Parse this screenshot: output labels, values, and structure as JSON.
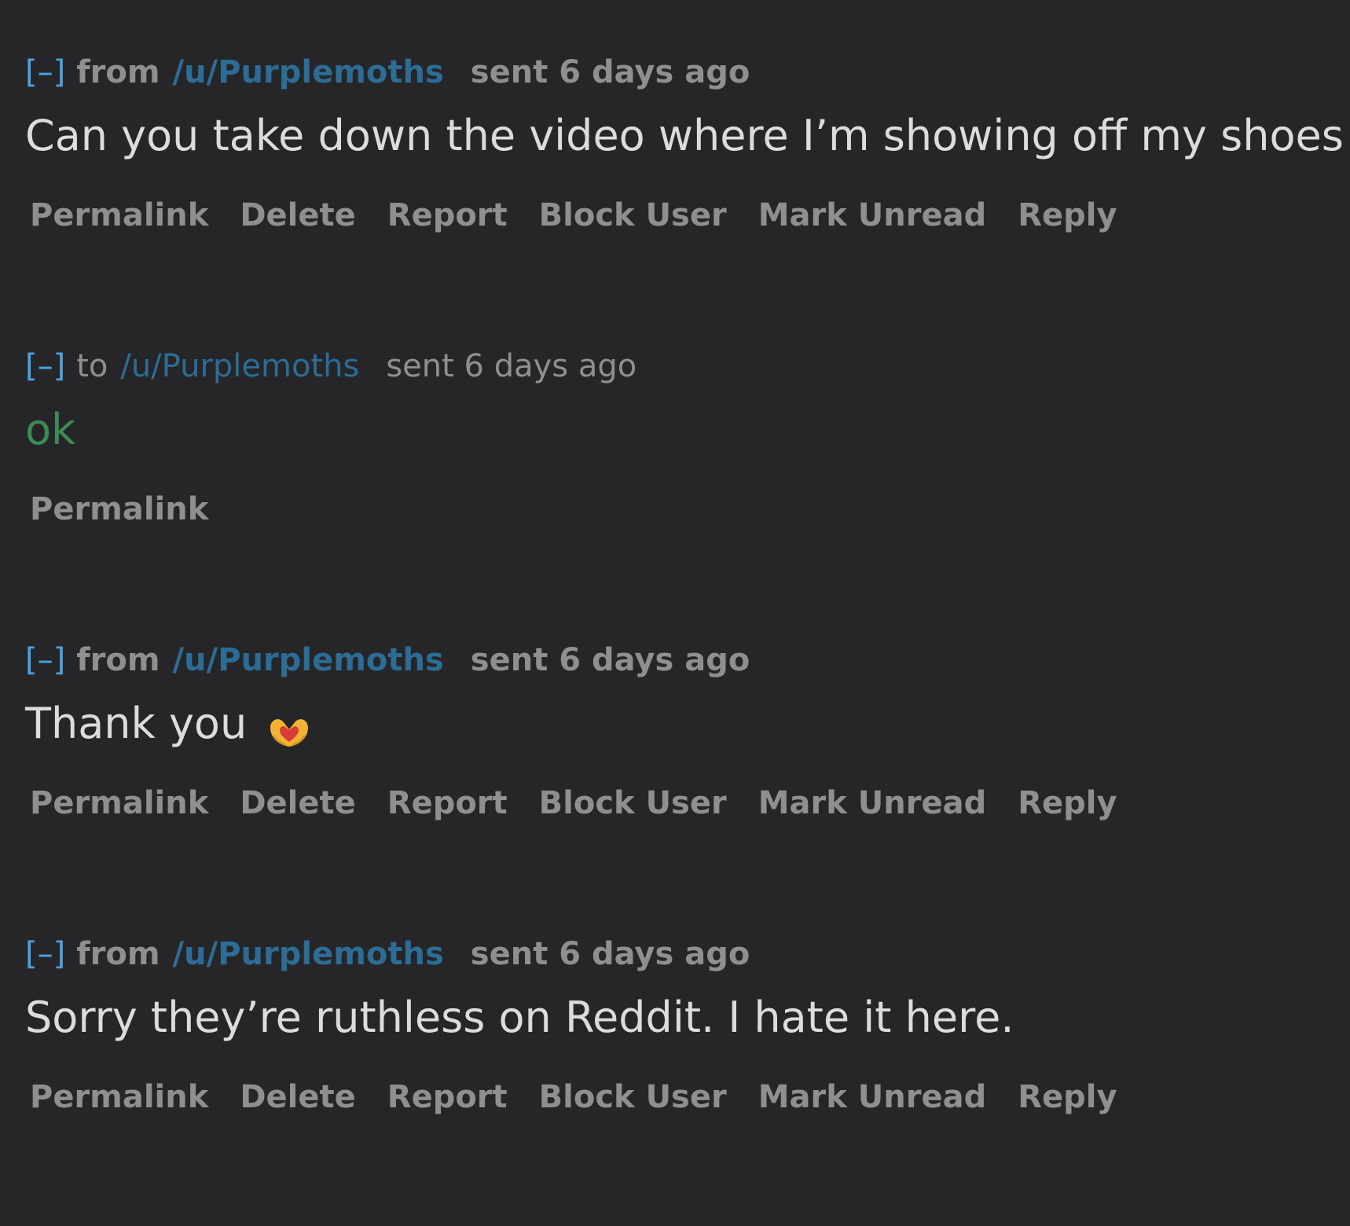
{
  "messages": [
    {
      "collapse": "[–]",
      "direction": "from",
      "author": "/u/Purplemoths",
      "timestamp": "sent 6 days ago",
      "body": "Can you take down the video where I’m showing off my shoes",
      "actions": [
        "Permalink",
        "Delete",
        "Report",
        "Block User",
        "Mark Unread",
        "Reply"
      ]
    },
    {
      "collapse": "[–]",
      "direction": "to",
      "author": "/u/Purplemoths",
      "timestamp": "sent 6 days ago",
      "body": "ok",
      "actions": [
        "Permalink"
      ]
    },
    {
      "collapse": "[–]",
      "direction": "from",
      "author": "/u/Purplemoths",
      "timestamp": "sent 6 days ago",
      "body": "Thank you",
      "emoji": "heart-hands-icon",
      "actions": [
        "Permalink",
        "Delete",
        "Report",
        "Block User",
        "Mark Unread",
        "Reply"
      ]
    },
    {
      "collapse": "[–]",
      "direction": "from",
      "author": "/u/Purplemoths",
      "timestamp": "sent 6 days ago",
      "body": "Sorry they’re ruthless on Reddit. I hate it here.",
      "actions": [
        "Permalink",
        "Delete",
        "Report",
        "Block User",
        "Mark Unread",
        "Reply"
      ]
    }
  ],
  "colors": {
    "background": "#262628",
    "collapse": "#4aa3df",
    "author": "#2c6c95",
    "meta": "#8f8f8f",
    "body": "#dcdcdc",
    "sent_body": "#3c8b56"
  }
}
